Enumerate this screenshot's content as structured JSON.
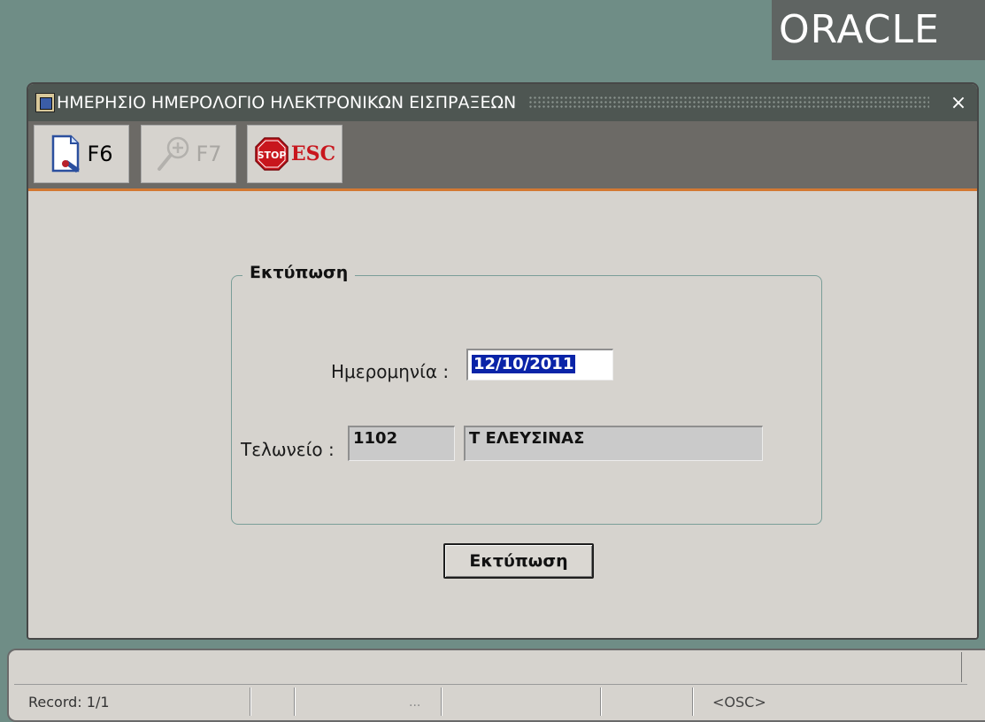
{
  "brand": {
    "logo_text": "ORACLE"
  },
  "window": {
    "title": "ΗΜΕΡΗΣΙΟ ΗΜΕΡΟΛΟΓΙΟ ΗΛΕΚΤΡΟΝΙΚΩΝ ΕΙΣΠΡΑΞΕΩΝ",
    "close_glyph": "×"
  },
  "toolbar": {
    "buttons": [
      {
        "label": "F6",
        "icon": "new-document-icon",
        "enabled": true
      },
      {
        "label": "F7",
        "icon": "zoom-search-icon",
        "enabled": false
      },
      {
        "label": "ESC",
        "icon": "stop-sign-icon",
        "stop_text": "STOP",
        "enabled": true
      }
    ]
  },
  "form": {
    "group_title": "Εκτύπωση",
    "date_label": "Ημερομηνία :",
    "date_value": "12/10/2011",
    "customs_label": "Τελωνείο :",
    "customs_code": "1102",
    "customs_name": "Τ ΕΛΕΥΣΙΝΑΣ",
    "print_button": "Εκτύπωση"
  },
  "status_bar": {
    "record": "Record: 1/1",
    "ellipsis": "...",
    "mode": "<OSC>"
  },
  "colors": {
    "desktop": "#6f8d86",
    "window_bg": "#d6d3ce",
    "accent_line": "#d37832",
    "selection": "#0a24a8"
  }
}
